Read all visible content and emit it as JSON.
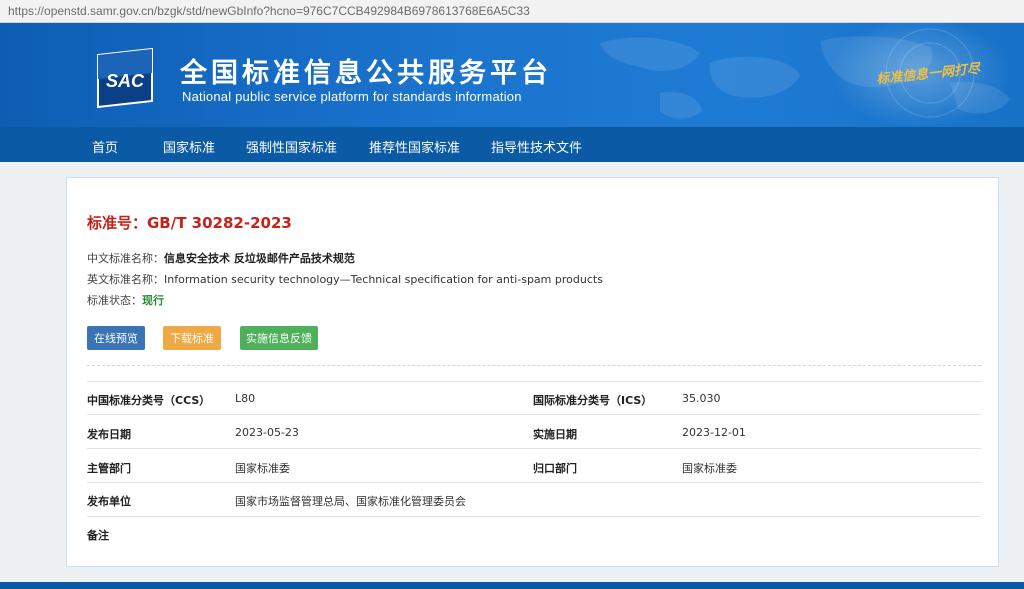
{
  "browser": {
    "url": "https://openstd.samr.gov.cn/bzgk/std/newGbInfo?hcno=976C7CCB492984B6978613768E6A5C33"
  },
  "header": {
    "logo_text": "SAC",
    "title_cn": "全国标准信息公共服务平台",
    "title_en": "National public service platform  for standards information",
    "slogan": "标准信息一网打尽"
  },
  "nav": {
    "items": [
      {
        "label": "首页"
      },
      {
        "label": "国家标准"
      },
      {
        "label": "强制性国家标准"
      },
      {
        "label": "推荐性国家标准"
      },
      {
        "label": "指导性技术文件"
      }
    ]
  },
  "standard": {
    "number_label": "标准号：GB/T 30282-2023",
    "cn_name_label": "中文标准名称：",
    "cn_name": "信息安全技术 反垃圾邮件产品技术规范",
    "en_name_label": "英文标准名称：",
    "en_name": "Information security technology—Technical specification for anti-spam products",
    "status_label": "标准状态：",
    "status": "现行"
  },
  "actions": {
    "preview": "在线预览",
    "download": "下载标准",
    "feedback": "实施信息反馈"
  },
  "details": {
    "ccs_label": "中国标准分类号（CCS）",
    "ccs_value": "L80",
    "ics_label": "国际标准分类号（ICS）",
    "ics_value": "35.030",
    "publish_date_label": "发布日期",
    "publish_date": "2023-05-23",
    "impl_date_label": "实施日期",
    "impl_date": "2023-12-01",
    "dept_label": "主管部门",
    "dept_value": "国家标准委",
    "owner_label": "归口部门",
    "owner_value": "国家标准委",
    "publisher_label": "发布单位",
    "publisher_value": "国家市场监督管理总局、国家标准化管理委员会",
    "remark_label": "备注"
  },
  "colors": {
    "banner": "#1a72cc",
    "nav": "#0a5aa6",
    "std_number": "#c4221b",
    "status": "#2a8a3a",
    "btn_preview": "#3a74b5",
    "btn_download": "#efa944",
    "btn_feedback": "#4eb05a"
  }
}
